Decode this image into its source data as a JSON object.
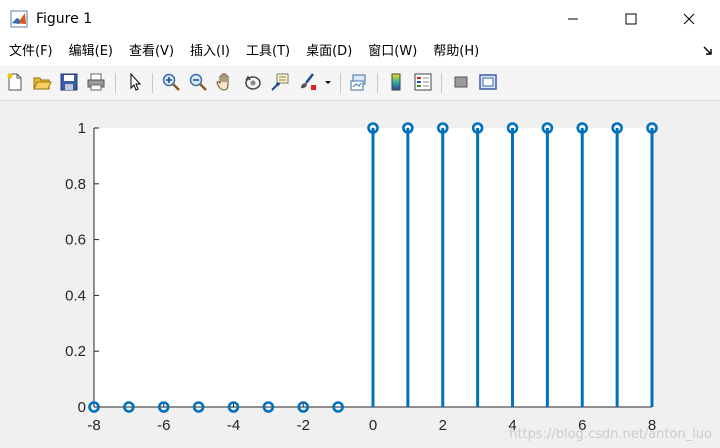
{
  "window": {
    "title": "Figure 1",
    "controls": [
      "minimize",
      "maximize",
      "close"
    ]
  },
  "menu": {
    "items": [
      "文件(F)",
      "编辑(E)",
      "查看(V)",
      "插入(I)",
      "工具(T)",
      "桌面(D)",
      "窗口(W)",
      "帮助(H)"
    ]
  },
  "toolbar": {
    "buttons": [
      {
        "icon": "new-figure-icon"
      },
      {
        "icon": "open-file-icon"
      },
      {
        "icon": "save-icon"
      },
      {
        "icon": "print-icon"
      },
      {
        "icon": "select-arrow-icon"
      },
      {
        "icon": "zoom-in-icon"
      },
      {
        "icon": "zoom-out-icon"
      },
      {
        "icon": "pan-hand-icon"
      },
      {
        "icon": "rotate-3d-icon"
      },
      {
        "icon": "data-cursor-icon"
      },
      {
        "icon": "brush-icon"
      },
      {
        "icon": "link-plot-icon"
      },
      {
        "icon": "colorbar-icon"
      },
      {
        "icon": "legend-icon"
      },
      {
        "icon": "hide-plot-tools-icon"
      },
      {
        "icon": "show-plot-tools-icon"
      }
    ]
  },
  "watermark": "https://blog.csdn.net/anton_luo",
  "colors": {
    "stem": "#0072bd",
    "axes_bg": "#ffffff",
    "figure_bg": "#f0f0f0",
    "axis_text": "#262626"
  },
  "chart_data": {
    "type": "stem",
    "x": [
      -8,
      -7,
      -6,
      -5,
      -4,
      -3,
      -2,
      -1,
      0,
      1,
      2,
      3,
      4,
      5,
      6,
      7,
      8
    ],
    "values": [
      0,
      0,
      0,
      0,
      0,
      0,
      0,
      0,
      1,
      1,
      1,
      1,
      1,
      1,
      1,
      1,
      1
    ],
    "xlim": [
      -8,
      8
    ],
    "ylim": [
      0,
      1
    ],
    "xticks": [
      -8,
      -6,
      -4,
      -2,
      0,
      2,
      4,
      6,
      8
    ],
    "yticks": [
      0,
      0.2,
      0.4,
      0.6,
      0.8,
      1
    ],
    "title": "",
    "xlabel": "",
    "ylabel": "",
    "grid": false
  }
}
